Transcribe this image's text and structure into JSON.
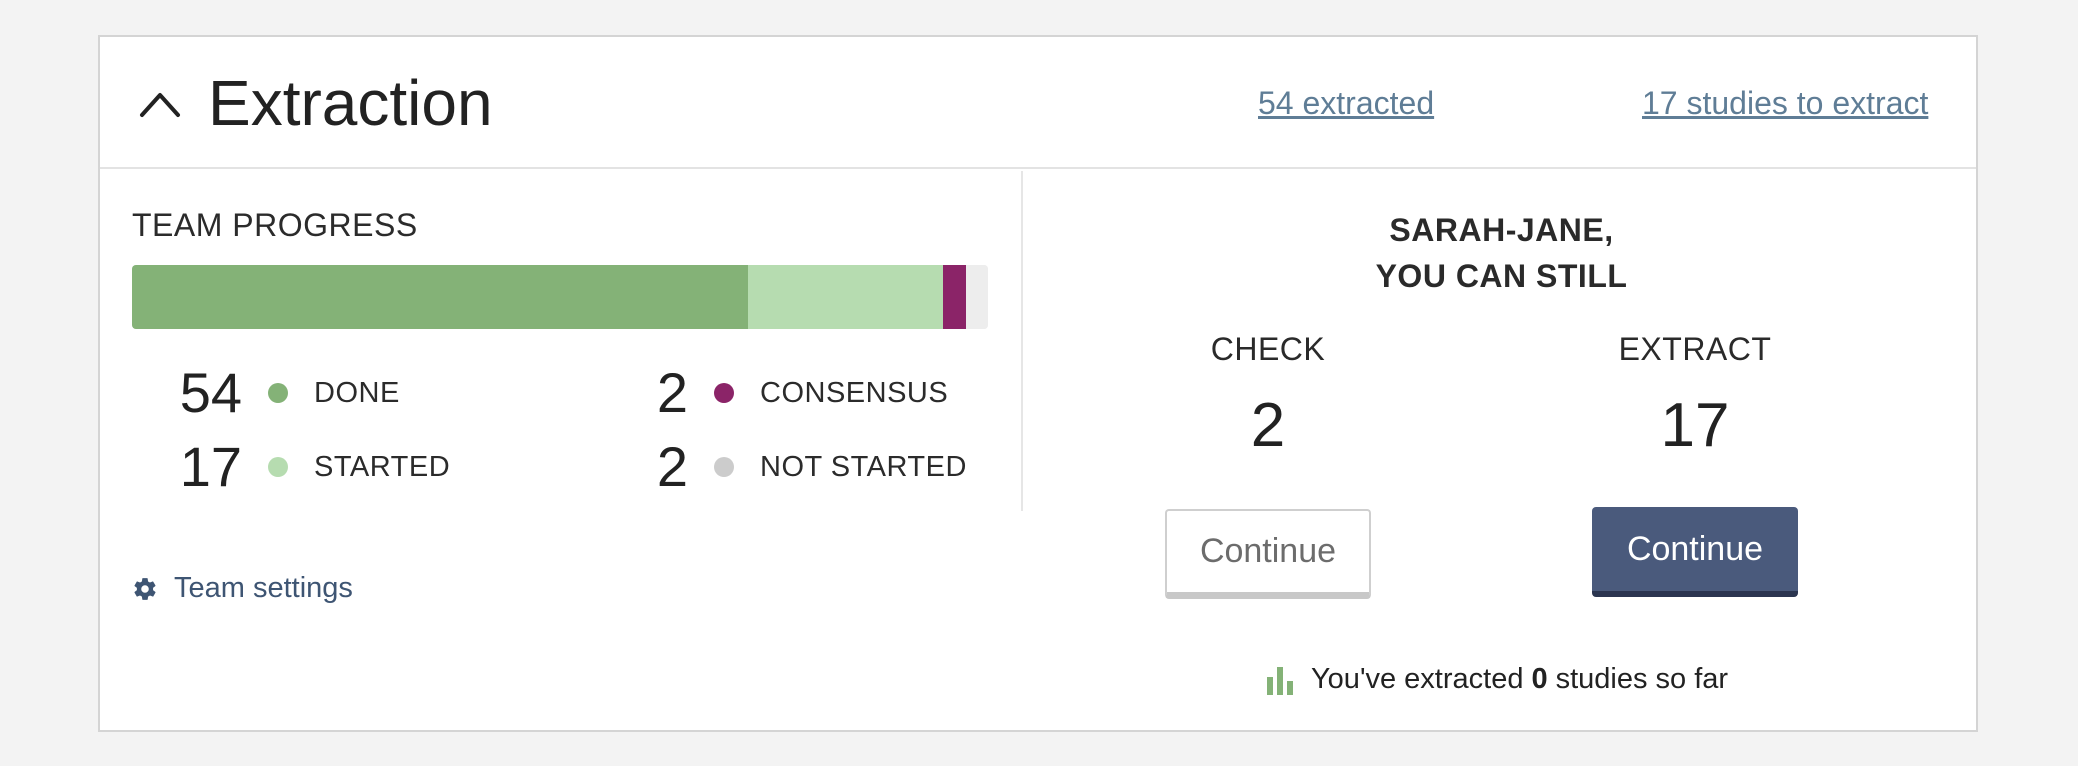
{
  "header": {
    "title": "Extraction",
    "extracted_link": "54 extracted",
    "to_extract_link": "17 studies to extract"
  },
  "team_progress": {
    "label": "TEAM PROGRESS",
    "bar_fractions": {
      "done": 0.72,
      "started": 0.227,
      "consensus": 0.027,
      "not_started": 0.026
    },
    "stats": {
      "done": {
        "value": "54",
        "label": "DONE",
        "color": "#84b277"
      },
      "started": {
        "value": "17",
        "label": "STARTED",
        "color": "#b6dcb0"
      },
      "consensus": {
        "value": "2",
        "label": "CONSENSUS",
        "color": "#8b2468"
      },
      "not_started": {
        "value": "2",
        "label": "NOT STARTED",
        "color": "#cccccc"
      }
    },
    "settings_label": "Team settings"
  },
  "personal": {
    "greeting_line1": "SARAH-JANE,",
    "greeting_line2": "YOU CAN STILL",
    "check": {
      "label": "CHECK",
      "count": "2",
      "button": "Continue"
    },
    "extract": {
      "label": "EXTRACT",
      "count": "17",
      "button": "Continue"
    },
    "so_far_prefix": "You've extracted",
    "so_far_count": "0",
    "so_far_suffix": "studies so far"
  },
  "colors": {
    "link": "#5f7d96",
    "primary_button": "#4a5a7c",
    "settings_link": "#3e5573"
  }
}
